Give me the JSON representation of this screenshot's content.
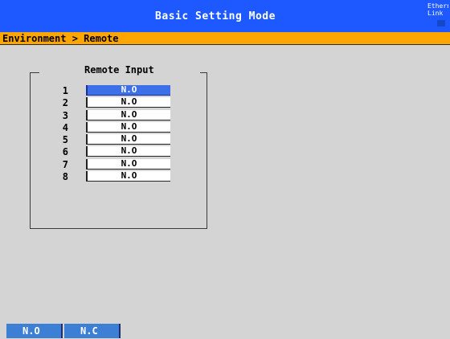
{
  "header": {
    "title": "Basic Setting Mode",
    "status_line1": "Etherne",
    "status_line2": "Link"
  },
  "breadcrumb": "Environment > Remote",
  "remote_input": {
    "label": "Remote Input",
    "rows": [
      {
        "num": "1",
        "value": "N.O"
      },
      {
        "num": "2",
        "value": "N.O"
      },
      {
        "num": "3",
        "value": "N.O"
      },
      {
        "num": "4",
        "value": "N.O"
      },
      {
        "num": "5",
        "value": "N.O"
      },
      {
        "num": "6",
        "value": "N.O"
      },
      {
        "num": "7",
        "value": "N.O"
      },
      {
        "num": "8",
        "value": "N.O"
      }
    ]
  },
  "softkeys": [
    {
      "label": "N.O"
    },
    {
      "label": "N.C"
    }
  ],
  "colors": {
    "title_bar": "#1d59ff",
    "breadcrumb_bar": "#ffa500",
    "selected_field": "#3d6fe8",
    "softkey": "#3e7fd6",
    "background": "#d4d4d4"
  }
}
